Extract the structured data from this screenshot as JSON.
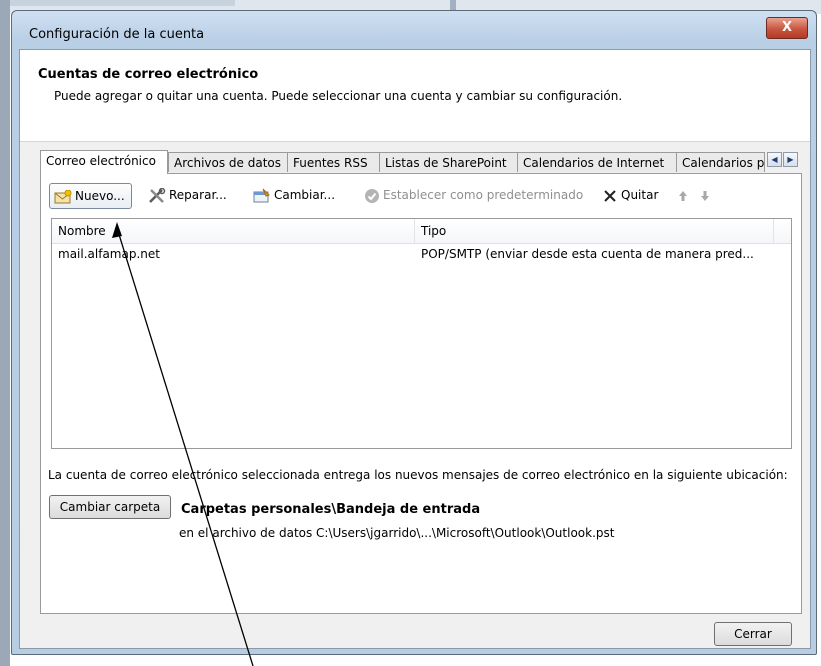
{
  "window": {
    "title": "Configuración de la cuenta",
    "close_glyph": "X"
  },
  "header": {
    "title": "Cuentas de correo electrónico",
    "subtitle": "Puede agregar o quitar una cuenta. Puede seleccionar una cuenta y cambiar su configuración."
  },
  "tabs": [
    {
      "label": "Correo electrónico",
      "active": true
    },
    {
      "label": "Archivos de datos"
    },
    {
      "label": "Fuentes RSS"
    },
    {
      "label": "Listas de SharePoint"
    },
    {
      "label": "Calendarios de Internet"
    },
    {
      "label": "Calendarios p"
    }
  ],
  "toolbar": {
    "new_label": "Nuevo...",
    "repair_label": "Reparar...",
    "change_label": "Cambiar...",
    "set_default_label": "Establecer como predeterminado",
    "remove_label": "Quitar"
  },
  "list": {
    "columns": [
      "Nombre",
      "Tipo"
    ],
    "rows": [
      {
        "name": "mail.alfamap.net",
        "type": "POP/SMTP (enviar desde esta cuenta de manera pred..."
      }
    ]
  },
  "delivery": {
    "description": "La cuenta de correo electrónico seleccionada entrega los nuevos mensajes de correo electrónico en la siguiente ubicación:",
    "change_folder_label": "Cambiar carpeta",
    "folder_name": "Carpetas personales\\Bandeja de entrada",
    "folder_path": "en el archivo de datos C:\\Users\\jgarrido\\...\\Microsoft\\Outlook\\Outlook.pst"
  },
  "footer": {
    "close_label": "Cerrar"
  },
  "colors": {
    "titlebar": "#b9cfe6",
    "close_button": "#c8553f"
  }
}
